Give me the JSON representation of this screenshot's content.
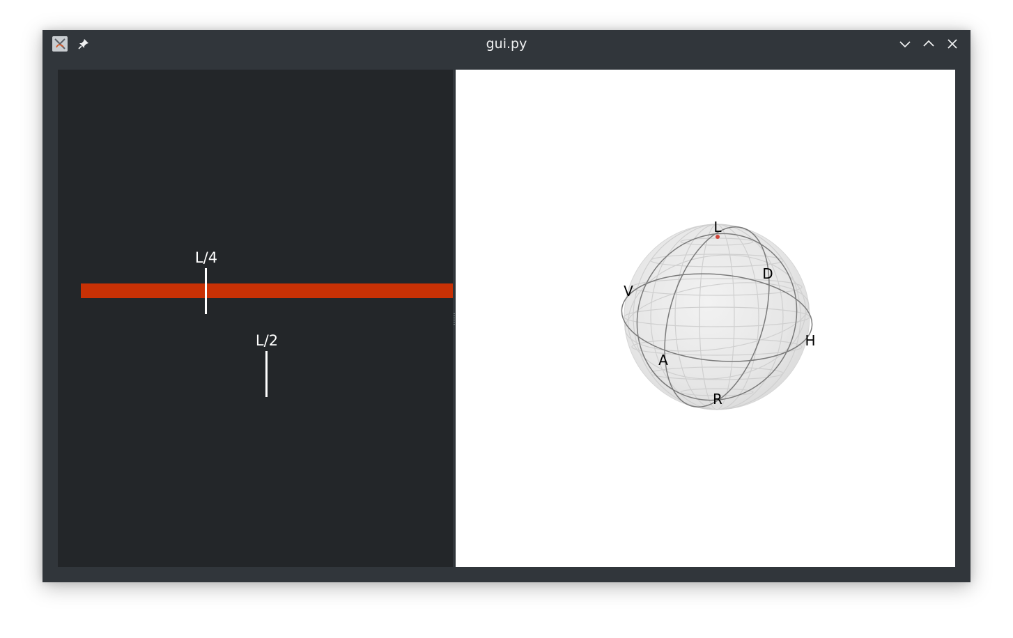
{
  "window": {
    "title": "gui.py",
    "icons": {
      "app": "app-icon",
      "pin": "pin-icon",
      "minimize": "chevron-down-icon",
      "maximize": "chevron-up-icon",
      "close": "close-icon"
    }
  },
  "left_panel": {
    "bar_color": "#c83105",
    "background": "#232629",
    "markers": [
      {
        "label": "L/4"
      },
      {
        "label": "L/2"
      }
    ]
  },
  "bloch_sphere": {
    "labels": {
      "L": "L",
      "D": "D",
      "V": "V",
      "H": "H",
      "A": "A",
      "R": "R"
    },
    "state_point_color": "#d0453a"
  }
}
